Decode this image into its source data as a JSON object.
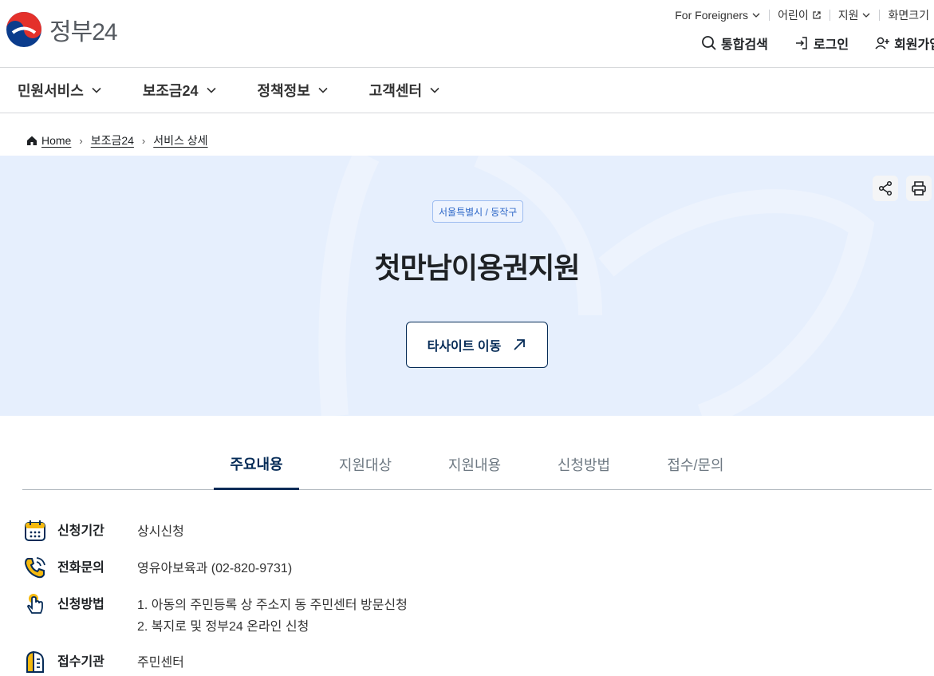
{
  "header": {
    "logo_text": "정부24",
    "utility": {
      "foreigners": "For Foreigners",
      "kids": "어린이",
      "support": "지원",
      "font_size": "화면크기"
    },
    "actions": {
      "search": "통합검색",
      "login": "로그인",
      "signup": "회원가입"
    }
  },
  "gnb": [
    {
      "label": "민원서비스"
    },
    {
      "label": "보조금24"
    },
    {
      "label": "정책정보"
    },
    {
      "label": "고객센터"
    }
  ],
  "breadcrumb": {
    "home": "Home",
    "level1": "보조금24",
    "level2": "서비스 상세"
  },
  "hero": {
    "region_tag": "서울특별시 / 동작구",
    "title": "첫만남이용권지원",
    "site_button": "타사이트 이동"
  },
  "tabs": [
    {
      "label": "주요내용",
      "active": true
    },
    {
      "label": "지원대상",
      "active": false
    },
    {
      "label": "지원내용",
      "active": false
    },
    {
      "label": "신청방법",
      "active": false
    },
    {
      "label": "접수/문의",
      "active": false
    }
  ],
  "info": {
    "period": {
      "label": "신청기간",
      "value": "상시신청",
      "icon": "calendar-icon"
    },
    "phone": {
      "label": "전화문의",
      "value": "영유아보육과 (02-820-9731)",
      "icon": "phone-icon"
    },
    "method": {
      "label": "신청방법",
      "line1": "1. 아동의 주민등록 상 주소지 동 주민센터 방문신청",
      "line2": "2. 복지로 및 정부24 온라인 신청",
      "icon": "hand-pointer-icon"
    },
    "agency": {
      "label": "접수기관",
      "value": "주민센터",
      "icon": "building-icon"
    }
  },
  "colors": {
    "primary": "#052b57",
    "hero_bg": "#e6effd",
    "tag_text": "#2e68c8",
    "accent_yellow": "#f5b90f"
  }
}
